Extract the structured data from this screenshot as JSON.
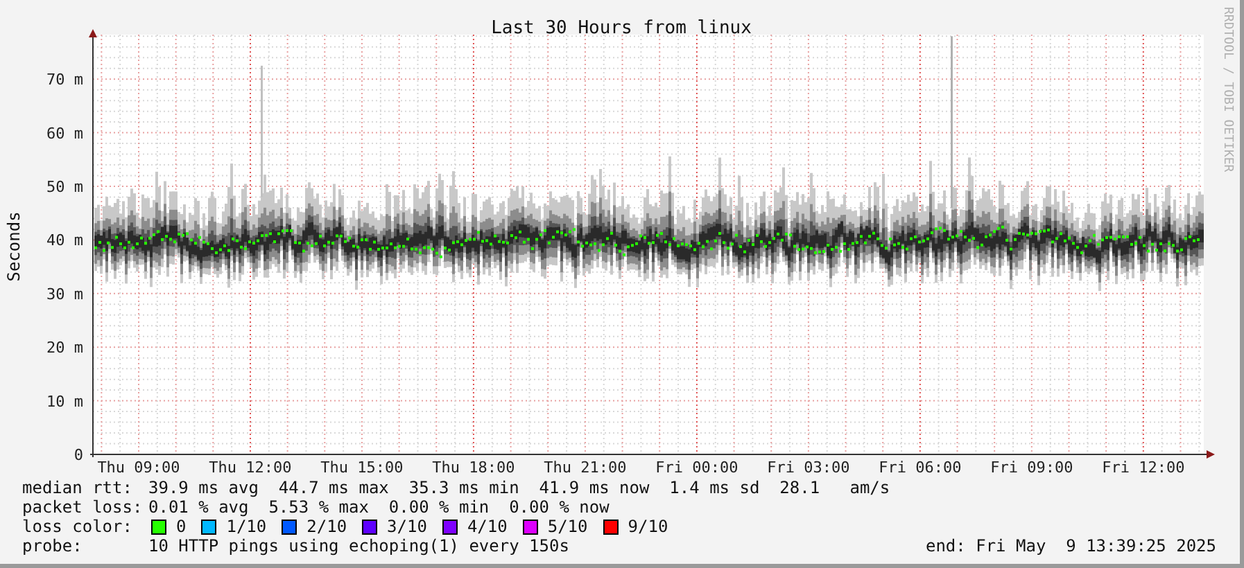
{
  "title": "Last 30 Hours from linux",
  "side_label": "RRDTOOL / TOBI OETIKER",
  "y_axis": {
    "label": "Seconds",
    "ticks": [
      "70 m",
      "60 m",
      "50 m",
      "40 m",
      "30 m",
      "20 m",
      "10 m",
      "0"
    ]
  },
  "x_axis": {
    "ticks": [
      "Thu 09:00",
      "Thu 12:00",
      "Thu 15:00",
      "Thu 18:00",
      "Thu 21:00",
      "Fri 00:00",
      "Fri 03:00",
      "Fri 06:00",
      "Fri 09:00",
      "Fri 12:00"
    ]
  },
  "legend": {
    "median_rtt": {
      "label": "median rtt:",
      "text": "39.9 ms avg  44.7 ms max  35.3 ms min  41.9 ms now  1.4 ms sd  28.1   am/s"
    },
    "packet_loss": {
      "label": "packet loss:",
      "text": "0.01 % avg  5.53 % max  0.00 % min  0.00 % now"
    },
    "loss_color": {
      "label": "loss color:",
      "items": [
        {
          "label": "0",
          "color": "#26ff00"
        },
        {
          "label": "1/10",
          "color": "#00b8ff"
        },
        {
          "label": "2/10",
          "color": "#0059ff"
        },
        {
          "label": "3/10",
          "color": "#5e00ff"
        },
        {
          "label": "4/10",
          "color": "#7e00ff"
        },
        {
          "label": "5/10",
          "color": "#dd00ff"
        },
        {
          "label": "9/10",
          "color": "#ff0000"
        }
      ]
    },
    "probe": {
      "label": "probe:",
      "text": "10 HTTP pings using echoping(1) every 150s"
    },
    "end": "end: Fri May  9 13:39:25 2025"
  }
}
